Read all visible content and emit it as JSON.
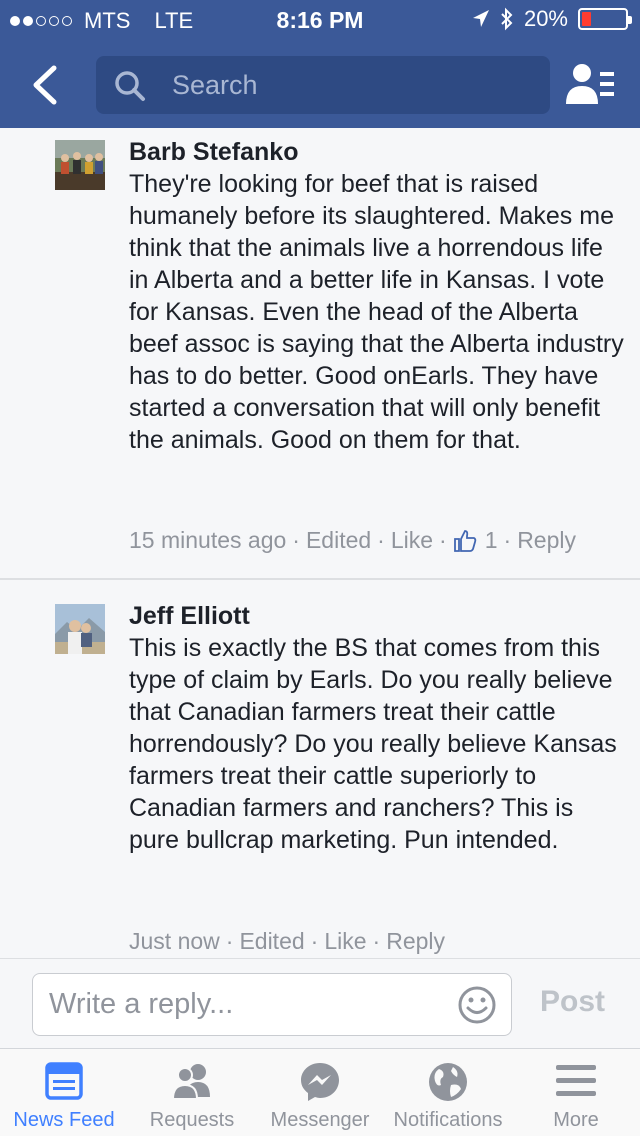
{
  "status_bar": {
    "carrier": "MTS",
    "network": "LTE",
    "time": "8:16 PM",
    "battery": "20%"
  },
  "header": {
    "search_placeholder": "Search"
  },
  "comments": [
    {
      "name": "Barb Stefanko",
      "text": "They're looking for beef that is raised humanely before its slaughtered. Makes me think that the animals live a horrendous life in Alberta and a better life in Kansas. I vote for Kansas. Even the head of the Alberta beef assoc is saying that the Alberta industry has to do better. Good onEarls. They have started a conversation that will only benefit the animals. Good on them for that.",
      "time": "15 minutes ago",
      "edited": "Edited",
      "like": "Like",
      "like_count": "1",
      "reply": "Reply"
    },
    {
      "name": "Jeff Elliott",
      "text": "This is exactly the BS that comes from this type of claim by Earls.  Do you really believe that Canadian farmers treat their cattle horrendously?  Do you really believe Kansas farmers treat their cattle superiorly to Canadian farmers and ranchers?  This is pure bullcrap marketing.  Pun intended.",
      "time": "Just now",
      "edited": "Edited",
      "like": "Like",
      "reply": "Reply"
    }
  ],
  "reply_bar": {
    "placeholder": "Write a reply...",
    "post_label": "Post"
  },
  "tab_bar": {
    "tabs": [
      {
        "label": "News Feed",
        "icon": "news-feed-icon"
      },
      {
        "label": "Requests",
        "icon": "requests-icon"
      },
      {
        "label": "Messenger",
        "icon": "messenger-icon"
      },
      {
        "label": "Notifications",
        "icon": "globe-icon"
      },
      {
        "label": "More",
        "icon": "menu-icon"
      }
    ],
    "active_color": "#4080ff",
    "inactive_color": "#90949c"
  },
  "colors": {
    "brand": "#3b5998",
    "link_blue": "#4080ff"
  }
}
